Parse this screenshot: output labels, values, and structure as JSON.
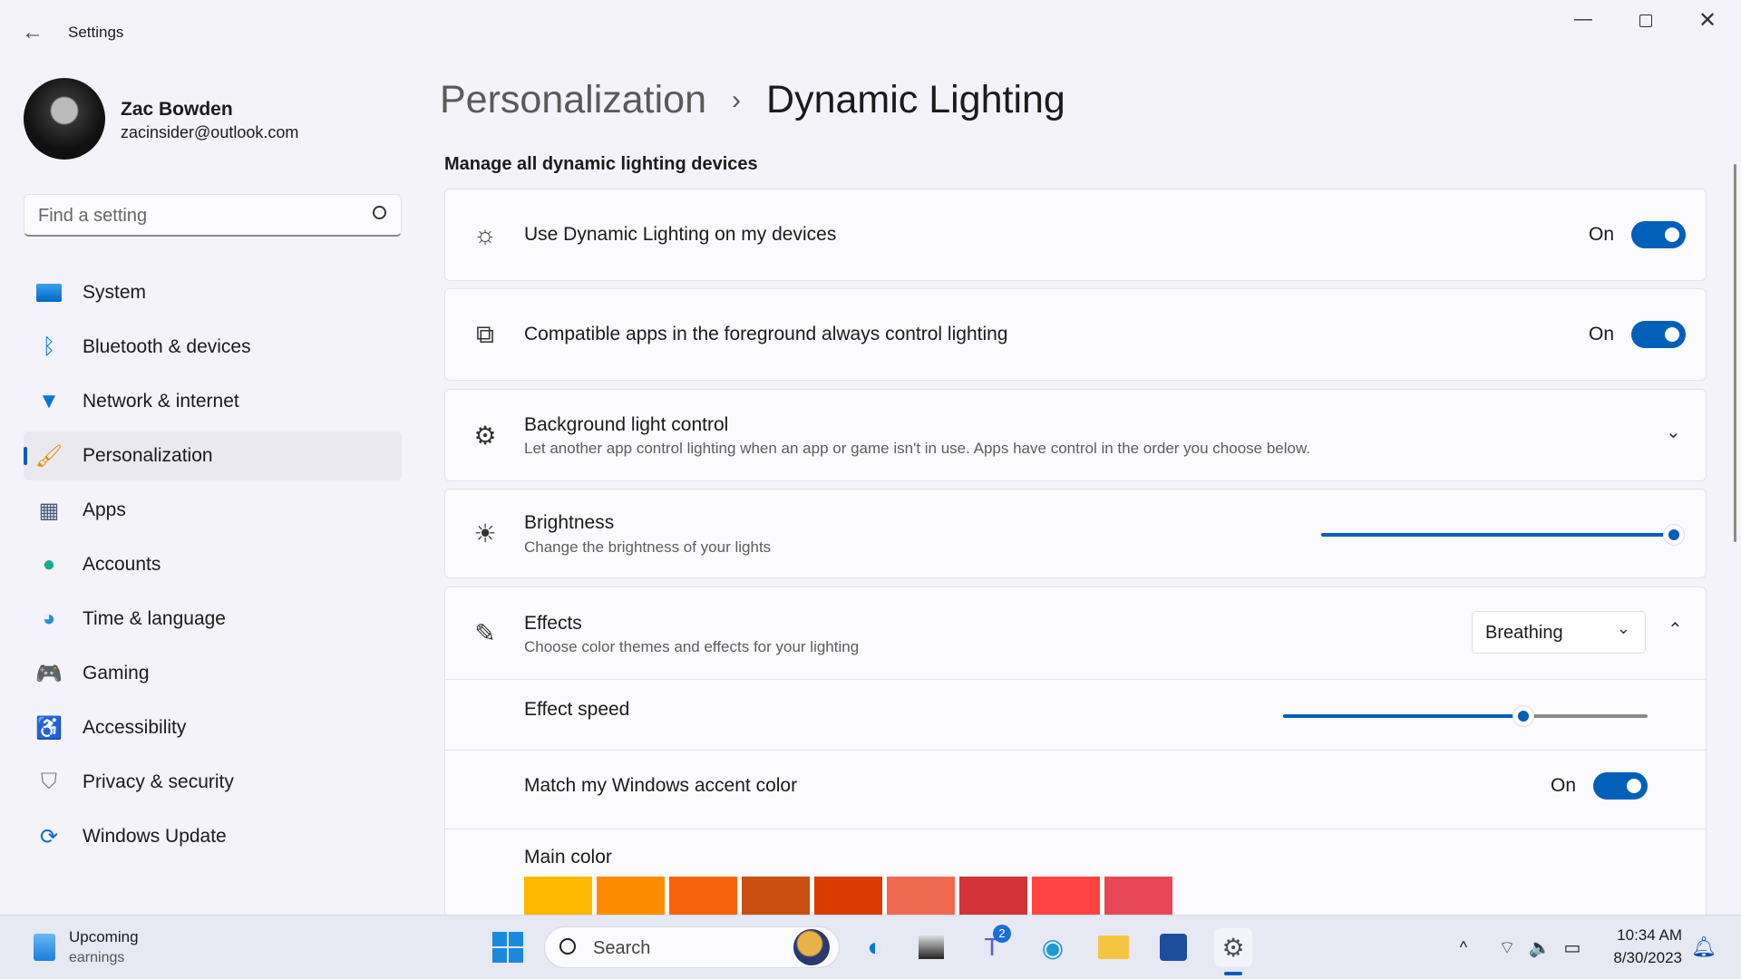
{
  "window": {
    "title": "Settings",
    "controls": [
      "minimize",
      "maximize",
      "close"
    ]
  },
  "user": {
    "name": "Zac Bowden",
    "email": "zacinsider@outlook.com"
  },
  "search": {
    "placeholder": "Find a setting"
  },
  "sidebar": {
    "items": [
      {
        "label": "System",
        "icon": "monitor-icon",
        "color": "#0078d4"
      },
      {
        "label": "Bluetooth & devices",
        "icon": "bluetooth-icon",
        "color": "#0078d4"
      },
      {
        "label": "Network & internet",
        "icon": "wifi-icon",
        "color": "#0078d4"
      },
      {
        "label": "Personalization",
        "icon": "brush-icon",
        "color": "#e68a00",
        "selected": true
      },
      {
        "label": "Apps",
        "icon": "apps-icon",
        "color": "#4a5a80"
      },
      {
        "label": "Accounts",
        "icon": "person-icon",
        "color": "#1aab8a"
      },
      {
        "label": "Time & language",
        "icon": "globe-clock-icon",
        "color": "#2a8fd6"
      },
      {
        "label": "Gaming",
        "icon": "gamepad-icon",
        "color": "#7a7a8a"
      },
      {
        "label": "Accessibility",
        "icon": "accessibility-icon",
        "color": "#0f6cbd"
      },
      {
        "label": "Privacy & security",
        "icon": "shield-icon",
        "color": "#7a7a80"
      },
      {
        "label": "Windows Update",
        "icon": "update-icon",
        "color": "#0f6cbd"
      }
    ]
  },
  "breadcrumb": {
    "parent": "Personalization",
    "separator": "›",
    "current": "Dynamic Lighting"
  },
  "section_title": "Manage all dynamic lighting devices",
  "settings": {
    "use_dynamic": {
      "title": "Use Dynamic Lighting on my devices",
      "state": "On"
    },
    "foreground": {
      "title": "Compatible apps in the foreground always control lighting",
      "state": "On"
    },
    "background": {
      "title": "Background light control",
      "desc": "Let another app control lighting when an app or game isn't in use. Apps have control in the order you choose below."
    },
    "brightness": {
      "title": "Brightness",
      "desc": "Change the brightness of your lights",
      "value": 100
    },
    "effects": {
      "title": "Effects",
      "desc": "Choose color themes and effects for your lighting",
      "selected": "Breathing"
    },
    "effect_speed": {
      "title": "Effect speed",
      "value": 66
    },
    "match_accent": {
      "title": "Match my Windows accent color",
      "state": "On"
    },
    "main_color": {
      "title": "Main color",
      "swatches": [
        "#FFB900",
        "#FF8C00",
        "#F7630C",
        "#CA5010",
        "#DA3B01",
        "#EF6950",
        "#D13438",
        "#FF4343",
        "#E74856"
      ]
    }
  },
  "accent": "#005fb8",
  "taskbar": {
    "widget_line1": "Upcoming",
    "widget_line2": "earnings",
    "search": "Search",
    "teams_badge": "2",
    "time": "10:34 AM",
    "date": "8/30/2023"
  }
}
